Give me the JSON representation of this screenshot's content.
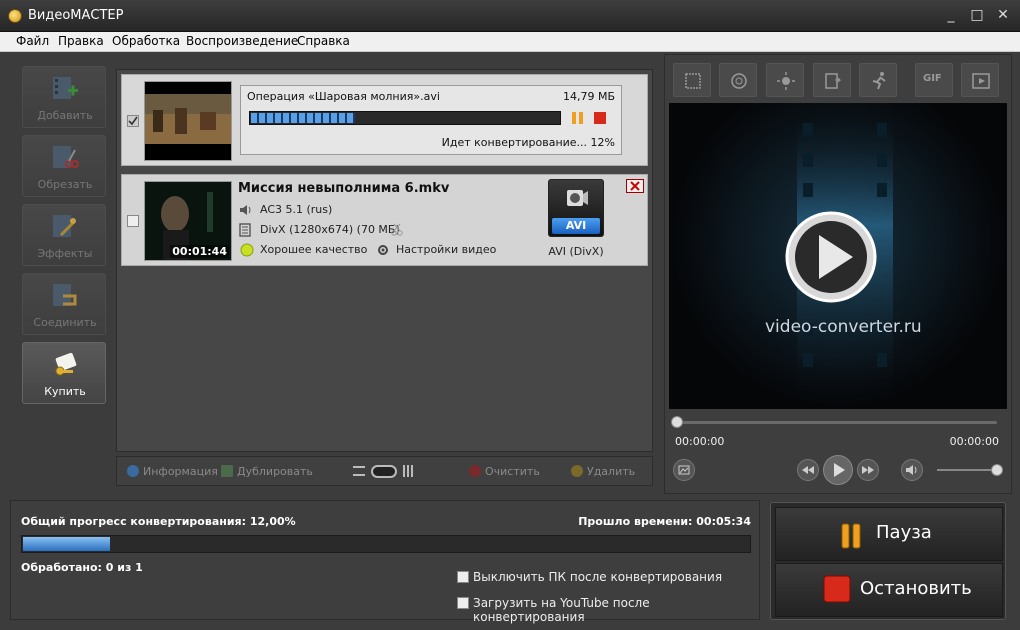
{
  "window": {
    "title": "ВидеоМАСТЕР",
    "minimize": "_",
    "maximize": "□",
    "close": "✕"
  },
  "menu": [
    "Файл",
    "Правка",
    "Обработка",
    "Воспроизведение",
    "Справка"
  ],
  "toolbar": {
    "add": "Добавить",
    "cut": "Обрезать",
    "effects": "Эффекты",
    "join": "Соединить",
    "buy": "Купить"
  },
  "files": [
    {
      "name": "Операция «Шаровая молния».avi",
      "size": "14,79 МБ",
      "status": "Идет конвертирование... 12%",
      "progress": 0.12
    },
    {
      "name": "Миссия невыполнима 6.mkv",
      "duration": "00:01:44",
      "audio": "AC3 5.1 (rus)",
      "video": "DivX (1280x674) (70 МБ)",
      "quality": "Хорошее качество",
      "settings": "Настройки видео",
      "format_badge": "AVI",
      "format": "AVI (DivX)"
    }
  ],
  "list_toolbar": {
    "info": "Информация",
    "duplicate": "Дублировать",
    "clear": "Очистить",
    "delete": "Удалить"
  },
  "player": {
    "watermark": "video-converter.ru",
    "time_start": "00:00:00",
    "time_end": "00:00:00",
    "gif_label": "GIF",
    "volume": 1.0,
    "position": 0.0
  },
  "progress": {
    "overall_label": "Общий прогресс конвертирования: 12,00%",
    "elapsed_label": "Прошло времени: 00:05:34",
    "processed_label": "Обработано: 0 из 1",
    "overall": 0.12,
    "shutdown_option": "Выключить ПК после конвертирования",
    "youtube_option": "Загрузить на YouTube после конвертирования"
  },
  "actions": {
    "pause": "Пауза",
    "stop": "Остановить"
  },
  "colors": {
    "accent_blue": "#4a8fd8",
    "stop_red": "#d82a1a",
    "pause_orange": "#f0a020"
  }
}
